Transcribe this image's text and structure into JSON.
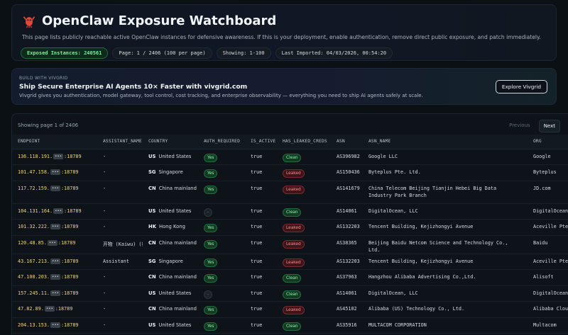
{
  "header": {
    "title": "OpenClaw Exposure Watchboard",
    "description": "This page lists publicly reachable active OpenClaw instances for defensive awareness. If this is your deployment, enable authentication, remove direct public exposure, and patch immediately.",
    "badges": {
      "exposed": "Exposed Instances: 240561",
      "page": "Page: 1 / 2406 (100 per page)",
      "showing": "Showing: 1-100",
      "imported": "Last Imported: 04/03/2026, 00:54:20"
    }
  },
  "promo": {
    "kicker": "BUILD WITH VIVGRID",
    "title": "Ship Secure Enterprise AI Agents 10× Faster with vivgrid.com",
    "subtitle": "Vivgrid gives you authentication, model gateway, tool control, cost tracking, and enterprise observability — everything you need to ship AI agents safely at scale.",
    "button": "Explore Vivgrid"
  },
  "table": {
    "status": "Showing page 1 of 2406",
    "prev_label": "Previous",
    "next_label": "Next",
    "mask": "•••",
    "columns": [
      "ENDPOINT",
      "ASSISTANT_NAME",
      "COUNTRY",
      "AUTH_REQUIRED",
      "IS_ACTIVE",
      "HAS_LEAKED_CREDS",
      "ASN",
      "ASN_NAME",
      "ORG"
    ],
    "rows": [
      {
        "ip": "136.118.191.",
        "port": ":18789",
        "assistant": "-",
        "cc": "US",
        "country": "United States",
        "auth": "Yes",
        "active": "true",
        "creds": "Clean",
        "asn": "AS396982",
        "asn_name": "Google LLC",
        "org": "Google"
      },
      {
        "ip": "101.47.158.",
        "port": ":18789",
        "assistant": "-",
        "cc": "SG",
        "country": "Singapore",
        "auth": "Yes",
        "active": "true",
        "creds": "Leaked",
        "asn": "AS150436",
        "asn_name": "Byteplus Pte. Ltd.",
        "org": "Byteplus"
      },
      {
        "ip": "117.72.159.",
        "port": ":18789",
        "assistant": "-",
        "cc": "CN",
        "country": "China mainland",
        "auth": "Yes",
        "active": "true",
        "creds": "Leaked",
        "asn": "AS141679",
        "asn_name": "China Telecom Beijing Tianjin Hebei Big Data Industry Park Branch",
        "org": "JD.com",
        "tall": true
      },
      {
        "ip": "104.131.164.",
        "port": ":18789",
        "assistant": "-",
        "cc": "US",
        "country": "United States",
        "auth": "-",
        "active": "true",
        "creds": "Clean",
        "asn": "AS14061",
        "asn_name": "DigitalOcean, LLC",
        "org": "DigitalOcean"
      },
      {
        "ip": "101.32.222.",
        "port": ":18789",
        "assistant": "-",
        "cc": "HK",
        "country": "Hong Kong",
        "auth": "Yes",
        "active": "true",
        "creds": "Leaked",
        "asn": "AS132203",
        "asn_name": "Tencent Building, Kejizhongyi Avenue",
        "org": "Aceville Pte"
      },
      {
        "ip": "120.48.85.",
        "port": ":18789",
        "assistant": "开物 (Kaiwu) (待机)",
        "cc": "CN",
        "country": "China mainland",
        "auth": "Yes",
        "active": "true",
        "creds": "Leaked",
        "asn": "AS38365",
        "asn_name": "Beijing Baidu Netcom Science and Technology Co., Ltd.",
        "org": "Baidu"
      },
      {
        "ip": "43.167.213.",
        "port": ":18789",
        "assistant": "Assistant",
        "cc": "SG",
        "country": "Singapore",
        "auth": "Yes",
        "active": "true",
        "creds": "Leaked",
        "asn": "AS132203",
        "asn_name": "Tencent Building, Kejizhongyi Avenue",
        "org": "Aceville Pte"
      },
      {
        "ip": "47.100.203.",
        "port": ":18789",
        "assistant": "-",
        "cc": "CN",
        "country": "China mainland",
        "auth": "Yes",
        "active": "true",
        "creds": "Clean",
        "asn": "AS37963",
        "asn_name": "Hangzhou Alibaba Advertising Co.,Ltd.",
        "org": "Alisoft"
      },
      {
        "ip": "157.245.11.",
        "port": ":18789",
        "assistant": "-",
        "cc": "US",
        "country": "United States",
        "auth": "-",
        "active": "true",
        "creds": "Clean",
        "asn": "AS14061",
        "asn_name": "DigitalOcean, LLC",
        "org": "DigitalOcean"
      },
      {
        "ip": "47.82.89.",
        "port": ":18789",
        "assistant": "-",
        "cc": "CN",
        "country": "China mainland",
        "auth": "Yes",
        "active": "true",
        "creds": "Leaked",
        "asn": "AS45102",
        "asn_name": "Alibaba (US) Technology Co., Ltd.",
        "org": "Alibaba Clou"
      },
      {
        "ip": "204.13.153.",
        "port": ":18789",
        "assistant": "-",
        "cc": "US",
        "country": "United States",
        "auth": "Yes",
        "active": "true",
        "creds": "Clean",
        "asn": "AS35916",
        "asn_name": "MULTACOM CORPORATION",
        "org": "Multacom"
      }
    ]
  }
}
